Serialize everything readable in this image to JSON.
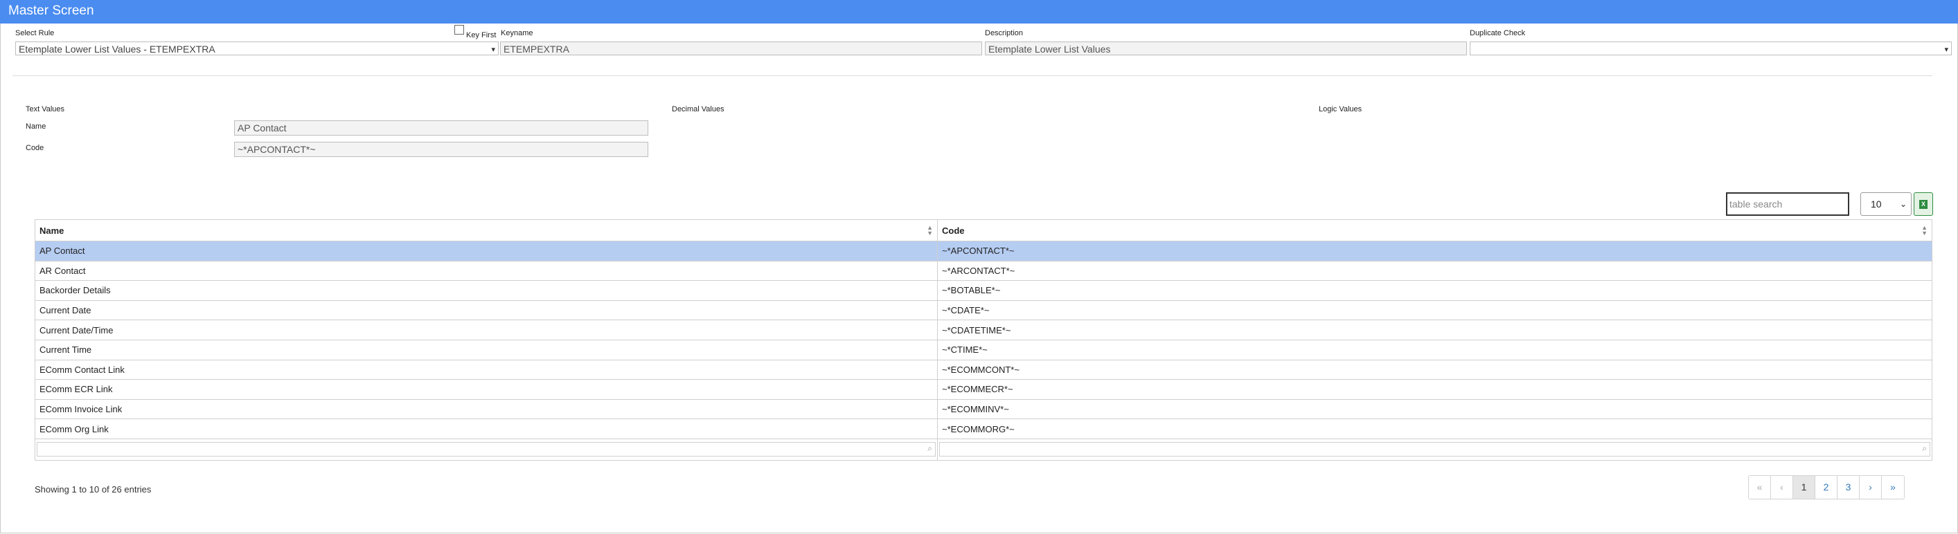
{
  "window": {
    "title": "Master Screen"
  },
  "form": {
    "select_rule": {
      "label": "Select Rule",
      "value": "Etemplate Lower List Values - ETEMPEXTRA"
    },
    "key_first_label": "Key First",
    "keyname": {
      "label": "Keyname",
      "value": "ETEMPEXTRA"
    },
    "description": {
      "label": "Description",
      "value": "Etemplate Lower List Values"
    },
    "duplicate_check": {
      "label": "Duplicate Check",
      "value": ""
    }
  },
  "sections": {
    "text_values": "Text Values",
    "decimal_values": "Decimal Values",
    "logic_values": "Logic Values"
  },
  "detail": {
    "name": {
      "label": "Name",
      "value": "AP Contact"
    },
    "code": {
      "label": "Code",
      "value": "~*APCONTACT*~"
    }
  },
  "table": {
    "search_placeholder": "table search",
    "page_length": "10",
    "columns": [
      "Name",
      "Code"
    ],
    "rows": [
      {
        "name": "AP Contact",
        "code": "~*APCONTACT*~"
      },
      {
        "name": "AR Contact",
        "code": "~*ARCONTACT*~"
      },
      {
        "name": "Backorder Details",
        "code": "~*BOTABLE*~"
      },
      {
        "name": "Current Date",
        "code": "~*CDATE*~"
      },
      {
        "name": "Current Date/Time",
        "code": "~*CDATETIME*~"
      },
      {
        "name": "Current Time",
        "code": "~*CTIME*~"
      },
      {
        "name": "EComm Contact Link",
        "code": "~*ECOMMCONT*~"
      },
      {
        "name": "EComm ECR Link",
        "code": "~*ECOMMECR*~"
      },
      {
        "name": "EComm Invoice Link",
        "code": "~*ECOMMINV*~"
      },
      {
        "name": "EComm Org Link",
        "code": "~*ECOMMORG*~"
      }
    ],
    "info": "Showing 1 to 10 of 26 entries"
  },
  "pagination": {
    "first": "«",
    "prev": "‹",
    "pages": [
      "1",
      "2",
      "3"
    ],
    "next": "›",
    "last": "»",
    "active_page": "1"
  },
  "colors": {
    "header_blue": "#4a8cf0",
    "selected_row": "#b6cdf2"
  }
}
